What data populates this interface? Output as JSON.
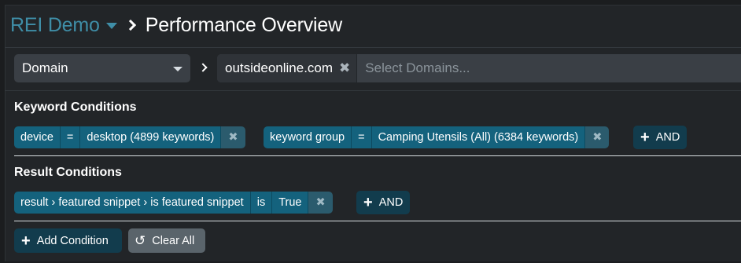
{
  "header": {
    "brand": "REI Demo",
    "title": "Performance Overview"
  },
  "domain_row": {
    "select_value": "Domain",
    "tags": [
      {
        "label": "outsideonline.com"
      }
    ],
    "input_placeholder": "Select Domains..."
  },
  "keyword_conditions": {
    "label": "Keyword Conditions",
    "conditions": [
      {
        "field": "device",
        "op": "=",
        "value": "desktop (4899 keywords)"
      },
      {
        "field": "keyword group",
        "op": "=",
        "value": "Camping Utensils (All) (6384 keywords)"
      }
    ],
    "and_label": "AND"
  },
  "result_conditions": {
    "label": "Result Conditions",
    "conditions": [
      {
        "field": "result › featured snippet › is featured snippet",
        "op": "is",
        "value": "True"
      }
    ],
    "and_label": "AND"
  },
  "actions": {
    "add_condition": "Add Condition",
    "clear_all": "Clear All"
  },
  "icons": {
    "remove": "close-icon",
    "add": "plus-icon",
    "undo": "undo-icon",
    "dropdown": "caret-down-icon",
    "breadcrumb": "chevron-right-icon"
  },
  "colors": {
    "brand": "#3f8ea7",
    "chip": "#14627d",
    "and_button": "#123c4d",
    "clear_button": "#5a646b"
  }
}
